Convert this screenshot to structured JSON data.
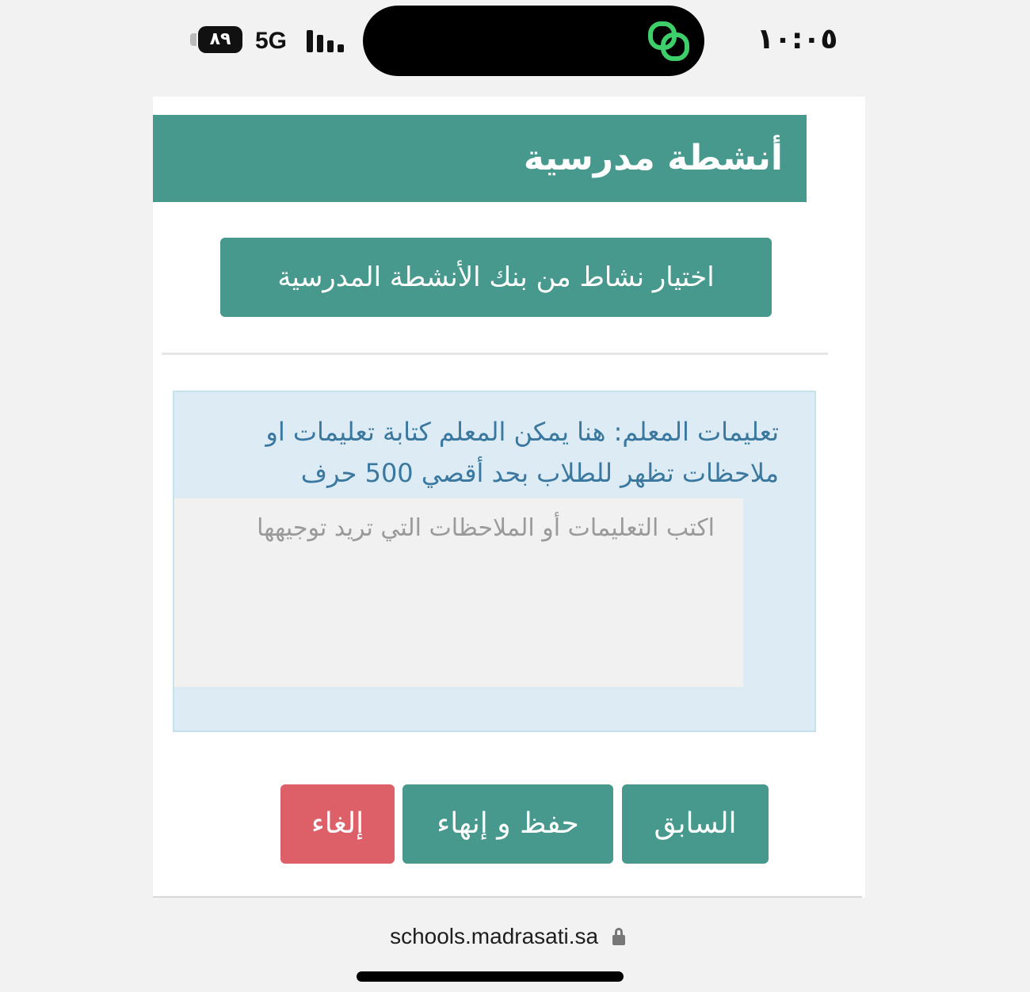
{
  "status_bar": {
    "time": "١٠:٠٥",
    "network": "5G",
    "battery": "٨٩",
    "island_icon": "green-linked-rings-icon"
  },
  "page": {
    "section_title": "أنشطة مدرسية",
    "bank_button_label": "اختيار نشاط من بنك الأنشطة المدرسية",
    "instructions_text": "تعليمات المعلم: هنا يمكن المعلم كتابة تعليمات او ملاحظات تظهر للطلاب بحد أقصي 500 حرف",
    "notes_placeholder": "اكتب التعليمات أو الملاحظات التي تريد توجيهها",
    "notes_value": "",
    "buttons": {
      "previous": "السابق",
      "save_finish": "حفظ و إنهاء",
      "cancel": "إلغاء"
    }
  },
  "url_bar": {
    "url": "schools.madrasati.sa",
    "icon": "lock-icon"
  },
  "colors": {
    "primary": "#46998c",
    "danger": "#dd5f68",
    "info_bg": "#dcebf4",
    "info_text": "#3a78a0"
  }
}
